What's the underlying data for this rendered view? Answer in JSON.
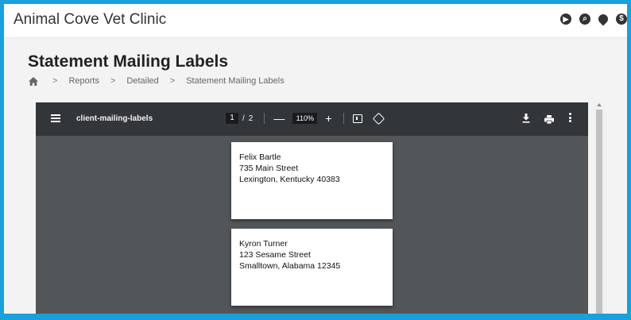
{
  "app": {
    "title": "Animal Cove Vet Clinic"
  },
  "top_icons": [
    {
      "name": "feed-icon",
      "glyph": "ϡ"
    },
    {
      "name": "search-icon",
      "glyph": "⌕"
    },
    {
      "name": "location-icon",
      "glyph": ""
    },
    {
      "name": "dollar-icon",
      "glyph": "$"
    }
  ],
  "page": {
    "title": "Statement Mailing Labels"
  },
  "breadcrumb": {
    "home_icon": "home-icon",
    "items": [
      "Reports",
      "Detailed",
      "Statement Mailing Labels"
    ],
    "separator": ">"
  },
  "viewer": {
    "filename": "client-mailing-labels",
    "current_page": "1",
    "page_separator": "/",
    "total_pages": "2",
    "zoom_out": "—",
    "zoom": "110%",
    "zoom_in": "+"
  },
  "labels": [
    {
      "name": "Felix Bartle",
      "street": "735 Main Street",
      "city_line": "Lexington, Kentucky 40383"
    },
    {
      "name": "Kyron Turner",
      "street": "123 Sesame Street",
      "city_line": "Smalltown, Alabama 12345"
    }
  ],
  "colors": {
    "frame_border": "#1aa0da",
    "toolbar": "#323639",
    "viewer_bg": "#525659"
  }
}
